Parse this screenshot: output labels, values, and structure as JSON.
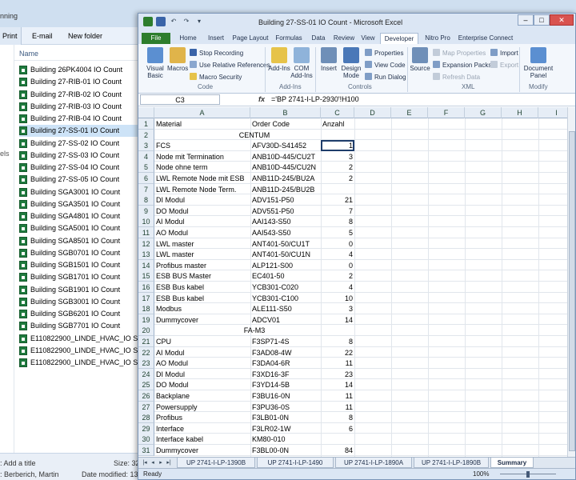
{
  "explorer": {
    "title_fragment": "nning",
    "toolbar": {
      "print": "Print",
      "email": "E-mail",
      "new_folder": "New folder"
    },
    "left_fragment": "els",
    "column_name": "Name",
    "files": [
      "Building 26PK4004 IO Count",
      "Building 27-RIB-01 IO Count",
      "Building 27-RIB-02 IO Count",
      "Building 27-RIB-03 IO Count",
      "Building 27-RIB-04 IO Count",
      "Building 27-SS-01 IO Count",
      "Building 27-SS-02 IO Count",
      "Building 27-SS-03 IO Count",
      "Building 27-SS-04 IO Count",
      "Building 27-SS-05 IO Count",
      "Building SGA3001 IO Count",
      "Building SGA3501 IO Count",
      "Building SGA4801 IO Count",
      "Building SGA5001 IO Count",
      "Building SGA8501 IO Count",
      "Building SGB0701 IO Count",
      "Building SGB1501 IO Count",
      "Building SGB1701 IO Count",
      "Building SGB1901 IO Count",
      "Building SGB3001 IO Count",
      "Building SGB6201 IO Count",
      "Building SGB7701 IO Count",
      "E110822900_LINDE_HVAC_IO Sizing",
      "E110822900_LINDE_HVAC_IO Sizing",
      "E110822900_LINDE_HVAC_IO Sizing"
    ],
    "selected_file_index": 5,
    "status": {
      "add_title": ": Add a title",
      "author": ": Berberich, Martin",
      "size_label": "Size: 32",
      "modified_label": "Date modified: 13"
    }
  },
  "excel": {
    "title": "Building 27-SS-01 IO Count  -  Microsoft Excel",
    "window_buttons": {
      "minimize": "–",
      "maximize": "□",
      "close": "✕"
    },
    "ribbon_tabs": [
      "File",
      "Home",
      "Insert",
      "Page Layout",
      "Formulas",
      "Data",
      "Review",
      "View",
      "Developer",
      "Nitro Pro",
      "Enterprise Connect"
    ],
    "active_tab": "Developer",
    "ribbon": {
      "visual_basic": "Visual Basic",
      "macros": "Macros",
      "record_macro": "Stop Recording",
      "relative_refs": "Use Relative References",
      "macro_security": "Macro Security",
      "group_code": "Code",
      "addins": "Add-Ins",
      "com_addins": "COM Add-Ins",
      "group_addins": "Add-Ins",
      "insert": "Insert",
      "design_mode": "Design Mode",
      "properties": "Properties",
      "view_code": "View Code",
      "run_dialog": "Run Dialog",
      "group_controls": "Controls",
      "source": "Source",
      "map_properties": "Map Properties",
      "expansion_packs": "Expansion Packs",
      "refresh_data": "Refresh Data",
      "import": "Import",
      "export": "Export",
      "group_xml": "XML",
      "document_panel": "Document Panel",
      "group_modify": "Modify"
    },
    "name_box": "C3",
    "fx_label": "fx",
    "formula": "='BP 2741-I-LP-2930'!H100",
    "columns": [
      "A",
      "B",
      "C",
      "D",
      "E",
      "F",
      "G",
      "H",
      "I"
    ],
    "rows": [
      {
        "n": "1",
        "a": "Material",
        "b": "Order Code",
        "c": "Anzahl"
      },
      {
        "n": "2",
        "merged": "CENTUM"
      },
      {
        "n": "3",
        "a": "FCS",
        "b": "AFV30D-S41452",
        "c": "1"
      },
      {
        "n": "4",
        "a": "Node mit Termination",
        "b": "ANB10D-445/CU2T",
        "c": "3"
      },
      {
        "n": "5",
        "a": "Node ohne term",
        "b": "ANB10D-445/CU2N",
        "c": "2"
      },
      {
        "n": "6",
        "a": "LWL Remote Node mit ESB",
        "b": "ANB11D-245/BU2A",
        "c": "2"
      },
      {
        "n": "7",
        "a": "LWL Remote Node Term.",
        "b": "ANB11D-245/BU2B",
        "c": ""
      },
      {
        "n": "8",
        "a": "DI Modul",
        "b": "ADV151-P50",
        "c": "21"
      },
      {
        "n": "9",
        "a": "DO Modul",
        "b": "ADV551-P50",
        "c": "7"
      },
      {
        "n": "10",
        "a": "AI Modul",
        "b": "AAI143-S50",
        "c": "8"
      },
      {
        "n": "11",
        "a": "AO Modul",
        "b": "AAI543-S50",
        "c": "5"
      },
      {
        "n": "12",
        "a": "LWL master",
        "b": "ANT401-50/CU1T",
        "c": "0"
      },
      {
        "n": "13",
        "a": "LWL master",
        "b": "ANT401-50/CU1N",
        "c": "4"
      },
      {
        "n": "14",
        "a": "Profibus master",
        "b": "ALP121-S00",
        "c": "0"
      },
      {
        "n": "15",
        "a": "ESB BUS Master",
        "b": "EC401-50",
        "c": "2"
      },
      {
        "n": "16",
        "a": "ESB Bus kabel",
        "b": "YCB301-C020",
        "c": "4"
      },
      {
        "n": "17",
        "a": "ESB Bus kabel",
        "b": "YCB301-C100",
        "c": "10"
      },
      {
        "n": "18",
        "a": "Modbus",
        "b": "ALE111-S50",
        "c": "3"
      },
      {
        "n": "19",
        "a": "Dummycover",
        "b": "ADCV01",
        "c": "14"
      },
      {
        "n": "20",
        "merged": "FA-M3"
      },
      {
        "n": "21",
        "a": "CPU",
        "b": "F3SP71-4S",
        "c": "8"
      },
      {
        "n": "22",
        "a": "AI Modul",
        "b": "F3AD08-4W",
        "c": "22"
      },
      {
        "n": "23",
        "a": "AO Modul",
        "b": "F3DA04-6R",
        "c": "11"
      },
      {
        "n": "24",
        "a": "DI Modul",
        "b": "F3XD16-3F",
        "c": "23"
      },
      {
        "n": "25",
        "a": "DO Modul",
        "b": "F3YD14-5B",
        "c": "14"
      },
      {
        "n": "26",
        "a": "Backplane",
        "b": "F3BU16-0N",
        "c": "11"
      },
      {
        "n": "27",
        "a": "Powersupply",
        "b": "F3PU36-0S",
        "c": "11"
      },
      {
        "n": "28",
        "a": "Profibus",
        "b": "F3LB01-0N",
        "c": "8"
      },
      {
        "n": "29",
        "a": "Interface",
        "b": "F3LR02-1W",
        "c": "6"
      },
      {
        "n": "30",
        "a": "Interface kabel",
        "b": "KM80-010",
        "c": ""
      },
      {
        "n": "31",
        "a": "Dummycover",
        "b": "F3BL00-0N",
        "c": "84"
      }
    ],
    "sheet_tabs": [
      "UP 2741-I-LP-1390B",
      "UP 2741-I-LP-1490",
      "UP 2741-I-LP-1890A",
      "UP 2741-I-LP-1890B",
      "Summary"
    ],
    "active_sheet": "Summary",
    "status_ready": "Ready",
    "zoom": "100%",
    "accent_file_tab": "#2d7d2d"
  }
}
